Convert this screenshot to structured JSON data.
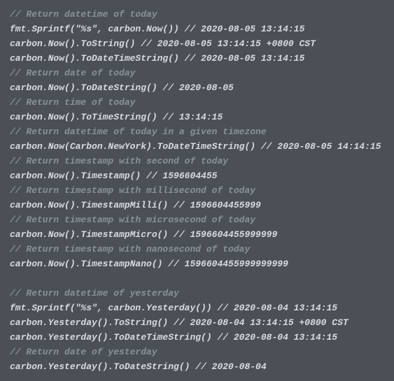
{
  "lines": [
    {
      "type": "comment",
      "text": "// Return datetime of today"
    },
    {
      "type": "code",
      "text": "fmt.Sprintf(\"%s\", carbon.Now()) // 2020-08-05 13:14:15"
    },
    {
      "type": "code",
      "text": "carbon.Now().ToString() // 2020-08-05 13:14:15 +0800 CST"
    },
    {
      "type": "code",
      "text": "carbon.Now().ToDateTimeString() // 2020-08-05 13:14:15"
    },
    {
      "type": "comment",
      "text": "// Return date of today"
    },
    {
      "type": "code",
      "text": "carbon.Now().ToDateString() // 2020-08-05"
    },
    {
      "type": "comment",
      "text": "// Return time of today"
    },
    {
      "type": "code",
      "text": "carbon.Now().ToTimeString() // 13:14:15"
    },
    {
      "type": "comment",
      "text": "// Return datetime of today in a given timezone"
    },
    {
      "type": "code",
      "text": "carbon.Now(Carbon.NewYork).ToDateTimeString() // 2020-08-05 14:14:15"
    },
    {
      "type": "comment",
      "text": "// Return timestamp with second of today"
    },
    {
      "type": "code",
      "text": "carbon.Now().Timestamp() // 1596604455"
    },
    {
      "type": "comment",
      "text": "// Return timestamp with millisecond of today"
    },
    {
      "type": "code",
      "text": "carbon.Now().TimestampMilli() // 1596604455999"
    },
    {
      "type": "comment",
      "text": "// Return timestamp with microsecond of today"
    },
    {
      "type": "code",
      "text": "carbon.Now().TimestampMicro() // 1596604455999999"
    },
    {
      "type": "comment",
      "text": "// Return timestamp with nanosecond of today"
    },
    {
      "type": "code",
      "text": "carbon.Now().TimestampNano() // 1596604455999999999"
    },
    {
      "type": "blank",
      "text": ""
    },
    {
      "type": "comment",
      "text": "// Return datetime of yesterday"
    },
    {
      "type": "code",
      "text": "fmt.Sprintf(\"%s\", carbon.Yesterday()) // 2020-08-04 13:14:15"
    },
    {
      "type": "code",
      "text": "carbon.Yesterday().ToString() // 2020-08-04 13:14:15 +0800 CST"
    },
    {
      "type": "code",
      "text": "carbon.Yesterday().ToDateTimeString() // 2020-08-04 13:14:15"
    },
    {
      "type": "comment",
      "text": "// Return date of yesterday"
    },
    {
      "type": "code",
      "text": "carbon.Yesterday().ToDateString() // 2020-08-04"
    }
  ]
}
